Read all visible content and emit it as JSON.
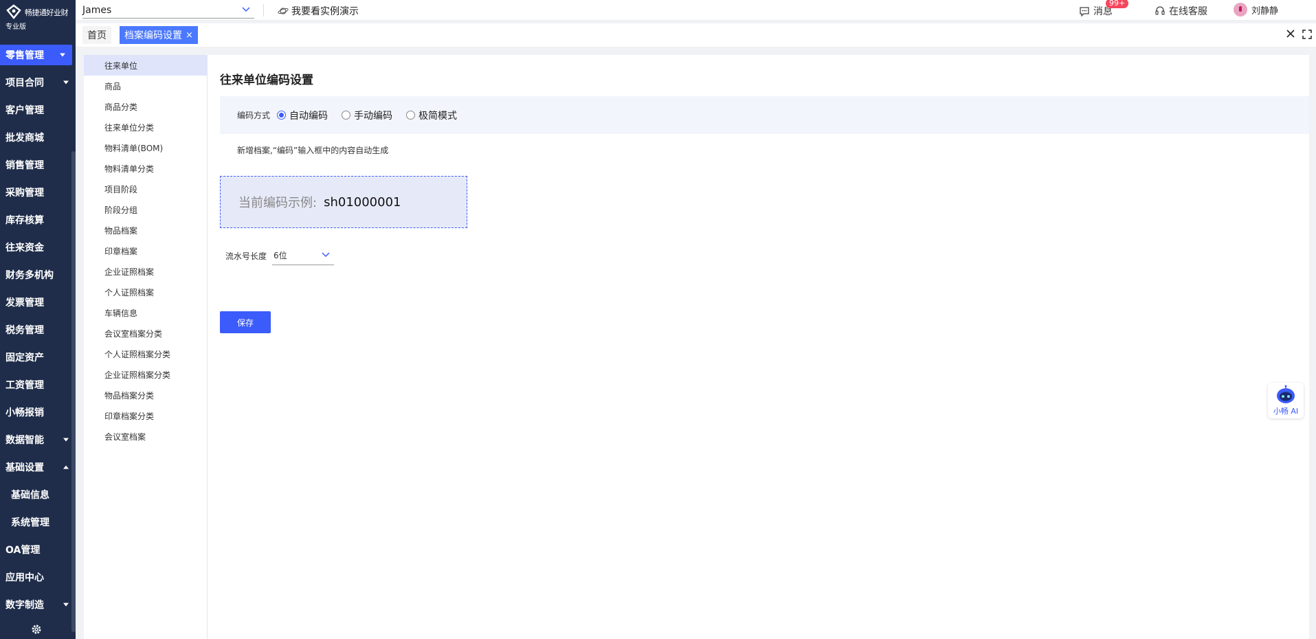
{
  "brand": {
    "name": "畅捷通好业财",
    "edition": "专业版",
    "accent": "#3b5bfb",
    "sidebar_bg": "#1f2d4a"
  },
  "sidebar": {
    "items": [
      {
        "label": "零售管理",
        "caret": "down",
        "active": true
      },
      {
        "label": "项目合同",
        "caret": "down"
      },
      {
        "label": "客户管理"
      },
      {
        "label": "批发商城"
      },
      {
        "label": "销售管理"
      },
      {
        "label": "采购管理"
      },
      {
        "label": "库存核算"
      },
      {
        "label": "往来资金"
      },
      {
        "label": "财务多机构"
      },
      {
        "label": "发票管理"
      },
      {
        "label": "税务管理"
      },
      {
        "label": "固定资产"
      },
      {
        "label": "工资管理"
      },
      {
        "label": "小畅报销"
      },
      {
        "label": "数据智能",
        "caret": "down"
      },
      {
        "label": "基础设置",
        "caret": "up"
      },
      {
        "label": "基础信息",
        "sub": true
      },
      {
        "label": "系统管理",
        "sub": true
      },
      {
        "label": "OA管理"
      },
      {
        "label": "应用中心"
      },
      {
        "label": "数字制造",
        "caret": "down"
      }
    ],
    "settings_icon": "gear-icon"
  },
  "topbar": {
    "account": "James",
    "demo_link": "我要看实例演示",
    "messages_label": "消息",
    "messages_badge": "99+",
    "service_label": "在线客服",
    "user_name": "刘静静"
  },
  "tabs": {
    "home": "首页",
    "active": "档案编码设置",
    "close_glyph": "×"
  },
  "subnav": {
    "items": [
      "往来单位",
      "商品",
      "商品分类",
      "往来单位分类",
      "物料清单(BOM)",
      "物料清单分类",
      "项目阶段",
      "阶段分组",
      "物品档案",
      "印章档案",
      "企业证照档案",
      "个人证照档案",
      "车辆信息",
      "会议室档案分类",
      "个人证照档案分类",
      "企业证照档案分类",
      "物品档案分类",
      "印章档案分类",
      "会议室档案"
    ],
    "active_index": 0
  },
  "main": {
    "title": "往来单位编码设置",
    "mode_label": "编码方式",
    "modes": [
      "自动编码",
      "手动编码",
      "极简模式"
    ],
    "selected_mode": 0,
    "description": "新增档案,“编码”输入框中的内容自动生成",
    "example_label": "当前编码示例:",
    "example_value": "sh01000001",
    "serial_label": "流水号长度",
    "serial_value": "6位",
    "save_label": "保存"
  },
  "ai_assistant": {
    "label": "小畅 AI"
  }
}
